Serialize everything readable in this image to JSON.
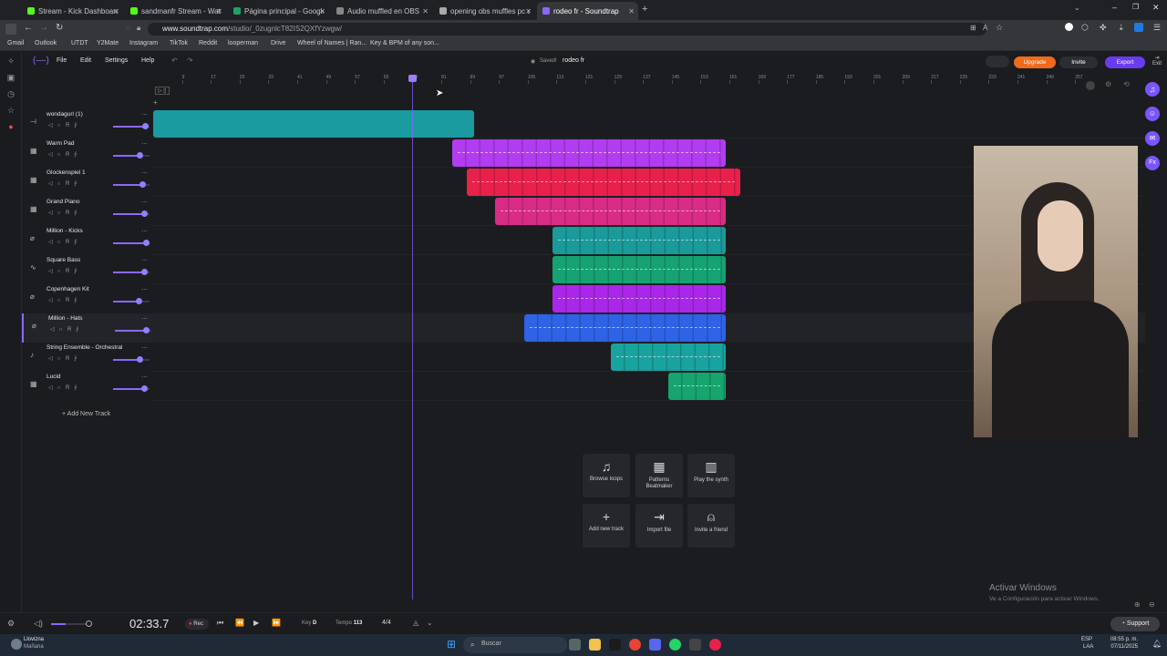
{
  "browser": {
    "tabs": [
      {
        "label": "Stream - Kick Dashboard",
        "active": false,
        "color": "#53fc18"
      },
      {
        "label": "sandmanfr Stream - Watch Live",
        "active": false,
        "color": "#53fc18"
      },
      {
        "label": "Página principal - Google Drive",
        "active": false,
        "color": "#1fa463"
      },
      {
        "label": "Audio muffled en OBS",
        "active": false,
        "color": "#888888"
      },
      {
        "label": "opening obs muffles pc audio",
        "active": false,
        "color": "#aaaaaa"
      },
      {
        "label": "rodeo fr - Soundtrap",
        "active": true,
        "color": "#8b67ff"
      }
    ],
    "url_prefix": "www.soundtrap.com",
    "url_path": "/studio/_0zugnlcT82IS2QXfYzwgw/",
    "bookmarks": [
      "Gmail",
      "Outlook",
      "UTDT",
      "Y2Mate",
      "Instagram",
      "TikTok",
      "Reddit",
      "looperman",
      "Drive",
      "Wheel of Names | Ran...",
      "Key & BPM of any son..."
    ]
  },
  "app": {
    "menu": [
      "File",
      "Edit",
      "Settings",
      "Help"
    ],
    "saved_label": "Saved!",
    "project_name": "rodeo fr",
    "upgrade_label": "Upgrade",
    "invite_label": "Invite",
    "export_label": "Export",
    "exit_label": "Exit",
    "accent": "#8b67ff"
  },
  "ruler": {
    "ticks": [
      "9",
      "17",
      "25",
      "33",
      "41",
      "49",
      "57",
      "65",
      "73",
      "81",
      "89",
      "97",
      "105",
      "113",
      "121",
      "129",
      "137",
      "145",
      "153",
      "161",
      "169",
      "177",
      "185",
      "193",
      "201",
      "209",
      "217",
      "225",
      "233",
      "241",
      "249",
      "257"
    ],
    "playhead_bar": 73
  },
  "tracks": [
    {
      "name": "wondagurl (1)",
      "icon": "wave-icon",
      "volume": 0.87,
      "clips": [
        {
          "start": 1,
          "end": 90,
          "color": "#1a9ba0"
        }
      ]
    },
    {
      "name": "Warm Pad",
      "icon": "keyboard-icon",
      "volume": 0.72,
      "clips": [
        {
          "start": 84,
          "end": 160,
          "color": "#b23cf0"
        }
      ]
    },
    {
      "name": "Glockenspiel 1",
      "icon": "keyboard-icon",
      "volume": 0.81,
      "clips": [
        {
          "start": 88,
          "end": 164,
          "color": "#e8214b"
        }
      ]
    },
    {
      "name": "Grand Piano",
      "icon": "keyboard-icon",
      "volume": 0.86,
      "clips": [
        {
          "start": 96,
          "end": 160,
          "color": "#d92c86"
        }
      ]
    },
    {
      "name": "Million - Kicks",
      "icon": "drum-icon",
      "volume": 0.89,
      "clips": [
        {
          "start": 112,
          "end": 160,
          "color": "#1b9a9a"
        }
      ]
    },
    {
      "name": "Square Bass",
      "icon": "synth-icon",
      "volume": 0.84,
      "clips": [
        {
          "start": 112,
          "end": 160,
          "color": "#17a273"
        }
      ]
    },
    {
      "name": "Copenhagen Kit",
      "icon": "drum-icon",
      "volume": 0.69,
      "clips": [
        {
          "start": 112,
          "end": 160,
          "color": "#a927e8"
        }
      ]
    },
    {
      "name": "Million - Hats",
      "icon": "drum-icon",
      "volume": 0.84,
      "clips": [
        {
          "start": 104,
          "end": 160,
          "color": "#2e63e6"
        }
      ]
    },
    {
      "name": "String Ensemble - Orchestral",
      "icon": "violin-icon",
      "volume": 0.72,
      "clips": [
        {
          "start": 128,
          "end": 160,
          "color": "#18a3a0"
        }
      ]
    },
    {
      "name": "Lucid",
      "icon": "keyboard-icon",
      "volume": 0.84,
      "clips": [
        {
          "start": 144,
          "end": 160,
          "color": "#16a56e"
        }
      ]
    }
  ],
  "add_track_label": "Add New Track",
  "quick_tiles": [
    {
      "label": "Browse loops",
      "icon": "music-note-icon"
    },
    {
      "label": "Patterns Beatmaker",
      "icon": "grid-pattern-icon"
    },
    {
      "label": "Play the synth",
      "icon": "piano-icon"
    },
    {
      "label": "Add new track",
      "icon": "plus-icon"
    },
    {
      "label": "Import file",
      "icon": "import-icon"
    },
    {
      "label": "Invite a friend",
      "icon": "add-person-icon"
    }
  ],
  "transport": {
    "time": "02:33.7",
    "rec_label": "Rec",
    "key_label": "Key",
    "key_value": "D",
    "tempo_label": "Tempo",
    "tempo_value": "113",
    "time_signature": "4/4",
    "support_label": "Support"
  },
  "watermark": {
    "title": "Activar Windows",
    "subtitle": "Ve a Configuración para activar Windows."
  },
  "taskbar": {
    "weather_line1": "Lloviznа",
    "weather_line2": "Mañana",
    "search_placeholder": "Buscar",
    "lang": "ESP",
    "lang_sub": "LAA",
    "time": "08:55 p. m.",
    "date": "07/11/2025"
  }
}
